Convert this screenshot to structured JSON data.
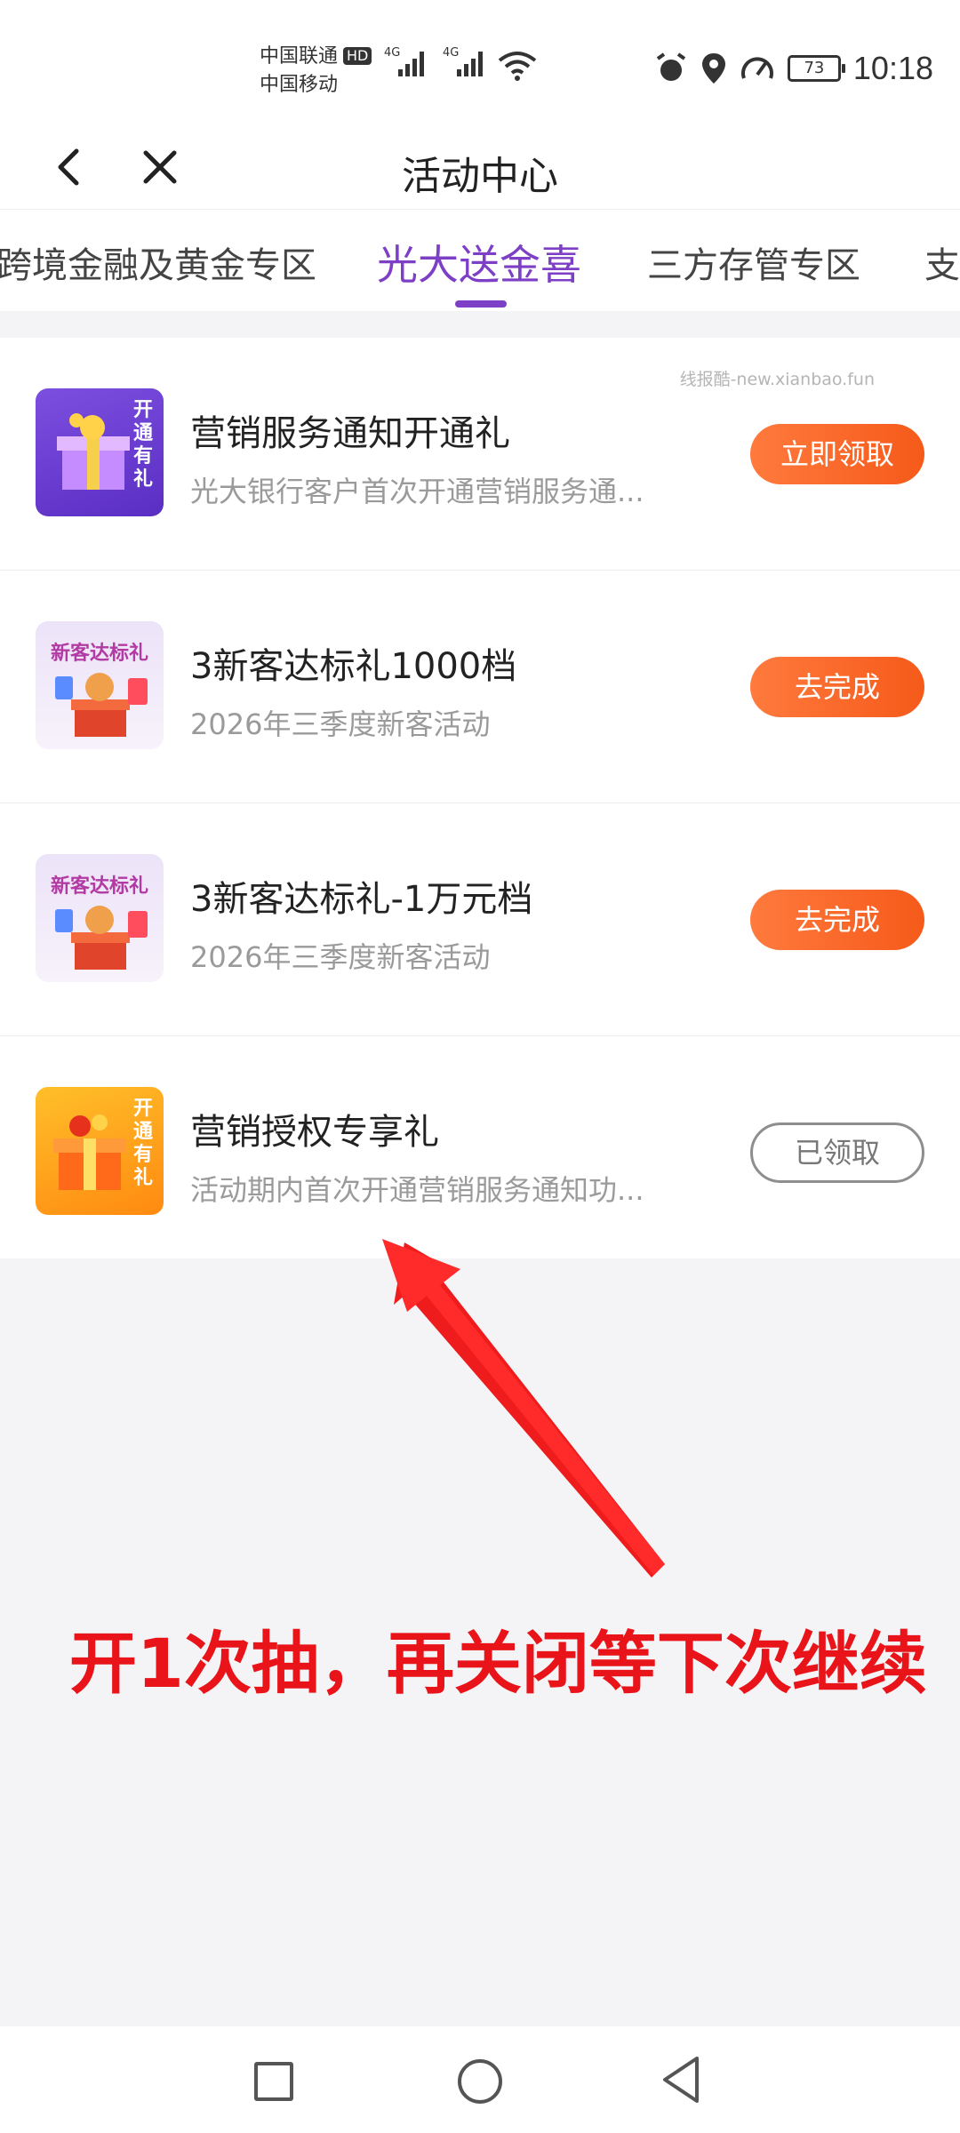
{
  "status_bar": {
    "carrier_1": "中国联通",
    "carrier_badge": "HD",
    "carrier_2": "中国移动",
    "signal_1_label": "4G",
    "signal_2_label": "4G",
    "battery": "73",
    "time": "10:18"
  },
  "header": {
    "title": "活动中心"
  },
  "tabs": [
    {
      "label": "跨境金融及黄金专区",
      "active": false
    },
    {
      "label": "光大送金喜",
      "active": true
    },
    {
      "label": "三方存管专区",
      "active": false
    },
    {
      "label": "支",
      "active": false
    }
  ],
  "watermark": "线报酷-new.xianbao.fun",
  "items": [
    {
      "title": "营销服务通知开通礼",
      "subtitle": "光大银行客户首次开通营销服务通...",
      "button": "立即领取",
      "thumb_text": "开通有礼"
    },
    {
      "title": "3新客达标礼1000档",
      "subtitle": "2026年三季度新客活动",
      "button": "去完成",
      "thumb_text": "新客达标礼"
    },
    {
      "title": "3新客达标礼-1万元档",
      "subtitle": "2026年三季度新客活动",
      "button": "去完成",
      "thumb_text": "新客达标礼"
    },
    {
      "title": "营销授权专享礼",
      "subtitle": "活动期内首次开通营销服务通知功...",
      "button": "已领取",
      "thumb_text": "开通有礼"
    }
  ],
  "annotation": "开1次抽，再关闭等下次继续",
  "colors": {
    "accent": "#7d3fc6",
    "button": "#f55a1a",
    "annotation": "#e8141a"
  }
}
